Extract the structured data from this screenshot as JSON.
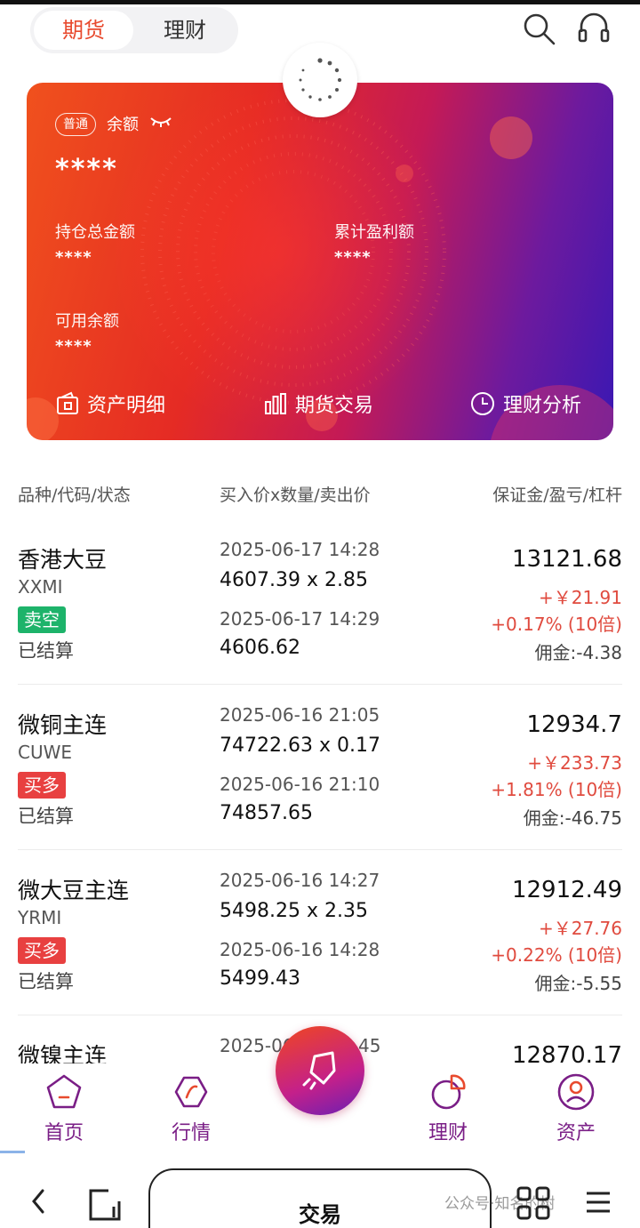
{
  "header": {
    "tabs": [
      {
        "label": "期货",
        "active": true
      },
      {
        "label": "理财",
        "active": false
      }
    ],
    "icons": [
      "search-icon",
      "headset-icon"
    ]
  },
  "card": {
    "badge": "普通",
    "balance_label": "余额",
    "balance_value": "****",
    "holdings_label": "持仓总金额",
    "holdings_value": "****",
    "profit_label": "累计盈利额",
    "profit_value": "****",
    "available_label": "可用余额",
    "available_value": "****",
    "actions": [
      {
        "label": "资产明细",
        "icon": "wallet-icon"
      },
      {
        "label": "期货交易",
        "icon": "bar-chart-icon"
      },
      {
        "label": "理财分析",
        "icon": "clock-icon"
      }
    ]
  },
  "table": {
    "headers": [
      "品种/代码/状态",
      "买入价x数量/卖出价",
      "保证金/盈亏/杠杆"
    ],
    "rows": [
      {
        "name": "香港大豆",
        "code": "XXMI",
        "side": "卖空",
        "side_color": "#1db36a",
        "status": "已结算",
        "open_time": "2025-06-17 14:28",
        "open_price_qty": "4607.39 x 2.85",
        "close_time": "2025-06-17 14:29",
        "close_price": "4606.62",
        "margin": "13121.68",
        "pnl": "+￥21.91",
        "pct_leverage": "+0.17% (10倍)",
        "commission": "佣金:-4.38"
      },
      {
        "name": "微铜主连",
        "code": "CUWE",
        "side": "买多",
        "side_color": "#e84040",
        "status": "已结算",
        "open_time": "2025-06-16 21:05",
        "open_price_qty": "74722.63 x 0.17",
        "close_time": "2025-06-16 21:10",
        "close_price": "74857.65",
        "margin": "12934.7",
        "pnl": "+￥233.73",
        "pct_leverage": "+1.81% (10倍)",
        "commission": "佣金:-46.75"
      },
      {
        "name": "微大豆主连",
        "code": "YRMI",
        "side": "买多",
        "side_color": "#e84040",
        "status": "已结算",
        "open_time": "2025-06-16 14:27",
        "open_price_qty": "5498.25 x 2.35",
        "close_time": "2025-06-16 14:28",
        "close_price": "5499.43",
        "margin": "12912.49",
        "pnl": "+￥27.76",
        "pct_leverage": "+0.22% (10倍)",
        "commission": "佣金:-5.55"
      },
      {
        "name": "微镍主连",
        "open_time": "2025-06",
        "open_time_tail": "45",
        "margin": "12870.17"
      }
    ]
  },
  "bottom_nav": {
    "items": [
      {
        "label": "首页",
        "icon": "home-icon"
      },
      {
        "label": "行情",
        "icon": "market-icon"
      },
      {
        "label": "理财",
        "icon": "finance-icon"
      },
      {
        "label": "资产",
        "icon": "profile-icon"
      }
    ],
    "center_icon": "rocket-icon"
  },
  "system_bar": {
    "center_label": "交易",
    "watermark": "公众号·知名的树"
  },
  "colors": {
    "accent": "#e84a2e",
    "nav_purple": "#7a1e86",
    "profit_red": "#e04b3f"
  }
}
